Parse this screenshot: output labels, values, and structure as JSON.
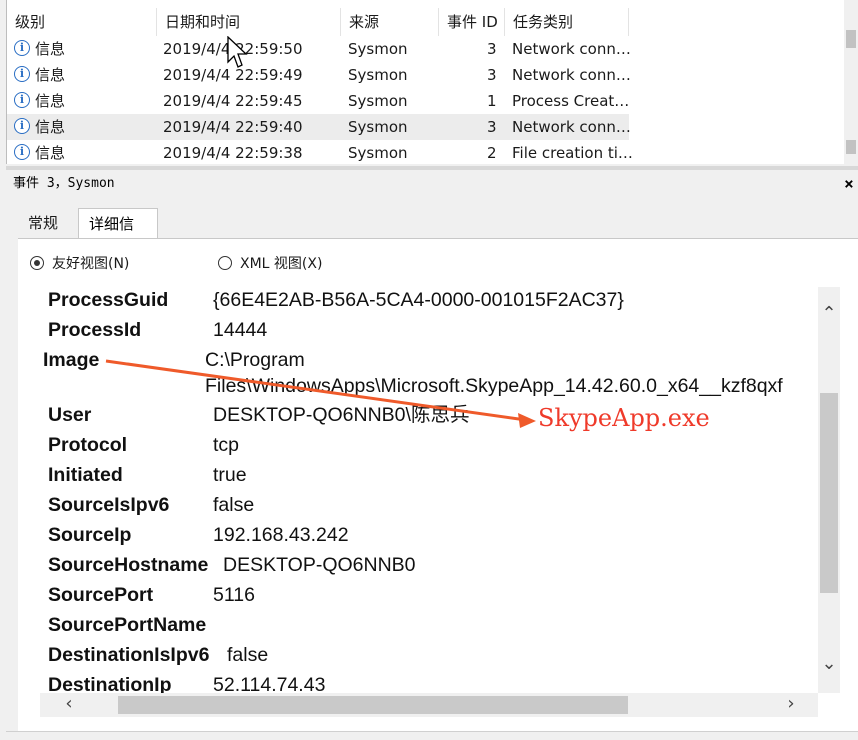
{
  "list": {
    "columns": [
      "级别",
      "日期和时间",
      "来源",
      "事件 ID",
      "任务类别"
    ],
    "rows": [
      {
        "level": "信息",
        "datetime": "2019/4/4 22:59:50",
        "source": "Sysmon",
        "event_id": "3",
        "task": "Network conn…"
      },
      {
        "level": "信息",
        "datetime": "2019/4/4 22:59:49",
        "source": "Sysmon",
        "event_id": "3",
        "task": "Network conn…"
      },
      {
        "level": "信息",
        "datetime": "2019/4/4 22:59:45",
        "source": "Sysmon",
        "event_id": "1",
        "task": "Process Creat…"
      },
      {
        "level": "信息",
        "datetime": "2019/4/4 22:59:40",
        "source": "Sysmon",
        "event_id": "3",
        "task": "Network conn…",
        "selected": true
      },
      {
        "level": "信息",
        "datetime": "2019/4/4 22:59:38",
        "source": "Sysmon",
        "event_id": "2",
        "task": "File creation ti…"
      }
    ]
  },
  "pane": {
    "title": "事件 3，Sysmon",
    "close": "×"
  },
  "tabs": {
    "general": "常规",
    "details": "详细信息"
  },
  "view": {
    "friendly": "友好视图(N)",
    "xml": "XML 视图(X)",
    "selected": "friendly"
  },
  "fields": [
    {
      "name": "ProcessGuid",
      "value": "{66E4E2AB-B56A-5CA4-0000-001015F2AC37}"
    },
    {
      "name": "ProcessId",
      "value": "14444"
    },
    {
      "name": "Image",
      "value": "C:\\Program",
      "value2": "Files\\WindowsApps\\Microsoft.SkypeApp_14.42.60.0_x64__kzf8qxf"
    },
    {
      "name": "User",
      "value": "DESKTOP-QO6NNB0\\陈思兵"
    },
    {
      "name": "Protocol",
      "value": "tcp"
    },
    {
      "name": "Initiated",
      "value": "true"
    },
    {
      "name": "SourceIsIpv6",
      "value": "false"
    },
    {
      "name": "SourceIp",
      "value": "192.168.43.242"
    },
    {
      "name": "SourceHostname",
      "value": "DESKTOP-QO6NNB0"
    },
    {
      "name": "SourcePort",
      "value": "5116"
    },
    {
      "name": "SourcePortName",
      "value": ""
    },
    {
      "name": "DestinationIsIpv6",
      "value": "false"
    },
    {
      "name": "DestinationIp",
      "value": "52.114.74.43"
    }
  ],
  "annotation": {
    "text": "SkypeApp.exe",
    "color": "#ef3a2a"
  },
  "icons": {
    "level": "info-icon",
    "scroll_up": "chevron-up-icon",
    "scroll_down": "chevron-down-icon",
    "scroll_left": "chevron-left-icon",
    "scroll_right": "chevron-right-icon"
  }
}
